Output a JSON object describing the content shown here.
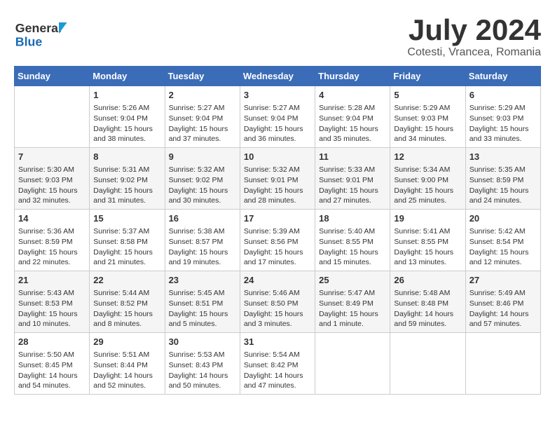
{
  "header": {
    "logo_line1": "General",
    "logo_line2": "Blue",
    "month_year": "July 2024",
    "location": "Cotesti, Vrancea, Romania"
  },
  "weekdays": [
    "Sunday",
    "Monday",
    "Tuesday",
    "Wednesday",
    "Thursday",
    "Friday",
    "Saturday"
  ],
  "weeks": [
    [
      {
        "day": "",
        "info": ""
      },
      {
        "day": "1",
        "info": "Sunrise: 5:26 AM\nSunset: 9:04 PM\nDaylight: 15 hours\nand 38 minutes."
      },
      {
        "day": "2",
        "info": "Sunrise: 5:27 AM\nSunset: 9:04 PM\nDaylight: 15 hours\nand 37 minutes."
      },
      {
        "day": "3",
        "info": "Sunrise: 5:27 AM\nSunset: 9:04 PM\nDaylight: 15 hours\nand 36 minutes."
      },
      {
        "day": "4",
        "info": "Sunrise: 5:28 AM\nSunset: 9:04 PM\nDaylight: 15 hours\nand 35 minutes."
      },
      {
        "day": "5",
        "info": "Sunrise: 5:29 AM\nSunset: 9:03 PM\nDaylight: 15 hours\nand 34 minutes."
      },
      {
        "day": "6",
        "info": "Sunrise: 5:29 AM\nSunset: 9:03 PM\nDaylight: 15 hours\nand 33 minutes."
      }
    ],
    [
      {
        "day": "7",
        "info": "Sunrise: 5:30 AM\nSunset: 9:03 PM\nDaylight: 15 hours\nand 32 minutes."
      },
      {
        "day": "8",
        "info": "Sunrise: 5:31 AM\nSunset: 9:02 PM\nDaylight: 15 hours\nand 31 minutes."
      },
      {
        "day": "9",
        "info": "Sunrise: 5:32 AM\nSunset: 9:02 PM\nDaylight: 15 hours\nand 30 minutes."
      },
      {
        "day": "10",
        "info": "Sunrise: 5:32 AM\nSunset: 9:01 PM\nDaylight: 15 hours\nand 28 minutes."
      },
      {
        "day": "11",
        "info": "Sunrise: 5:33 AM\nSunset: 9:01 PM\nDaylight: 15 hours\nand 27 minutes."
      },
      {
        "day": "12",
        "info": "Sunrise: 5:34 AM\nSunset: 9:00 PM\nDaylight: 15 hours\nand 25 minutes."
      },
      {
        "day": "13",
        "info": "Sunrise: 5:35 AM\nSunset: 8:59 PM\nDaylight: 15 hours\nand 24 minutes."
      }
    ],
    [
      {
        "day": "14",
        "info": "Sunrise: 5:36 AM\nSunset: 8:59 PM\nDaylight: 15 hours\nand 22 minutes."
      },
      {
        "day": "15",
        "info": "Sunrise: 5:37 AM\nSunset: 8:58 PM\nDaylight: 15 hours\nand 21 minutes."
      },
      {
        "day": "16",
        "info": "Sunrise: 5:38 AM\nSunset: 8:57 PM\nDaylight: 15 hours\nand 19 minutes."
      },
      {
        "day": "17",
        "info": "Sunrise: 5:39 AM\nSunset: 8:56 PM\nDaylight: 15 hours\nand 17 minutes."
      },
      {
        "day": "18",
        "info": "Sunrise: 5:40 AM\nSunset: 8:55 PM\nDaylight: 15 hours\nand 15 minutes."
      },
      {
        "day": "19",
        "info": "Sunrise: 5:41 AM\nSunset: 8:55 PM\nDaylight: 15 hours\nand 13 minutes."
      },
      {
        "day": "20",
        "info": "Sunrise: 5:42 AM\nSunset: 8:54 PM\nDaylight: 15 hours\nand 12 minutes."
      }
    ],
    [
      {
        "day": "21",
        "info": "Sunrise: 5:43 AM\nSunset: 8:53 PM\nDaylight: 15 hours\nand 10 minutes."
      },
      {
        "day": "22",
        "info": "Sunrise: 5:44 AM\nSunset: 8:52 PM\nDaylight: 15 hours\nand 8 minutes."
      },
      {
        "day": "23",
        "info": "Sunrise: 5:45 AM\nSunset: 8:51 PM\nDaylight: 15 hours\nand 5 minutes."
      },
      {
        "day": "24",
        "info": "Sunrise: 5:46 AM\nSunset: 8:50 PM\nDaylight: 15 hours\nand 3 minutes."
      },
      {
        "day": "25",
        "info": "Sunrise: 5:47 AM\nSunset: 8:49 PM\nDaylight: 15 hours\nand 1 minute."
      },
      {
        "day": "26",
        "info": "Sunrise: 5:48 AM\nSunset: 8:48 PM\nDaylight: 14 hours\nand 59 minutes."
      },
      {
        "day": "27",
        "info": "Sunrise: 5:49 AM\nSunset: 8:46 PM\nDaylight: 14 hours\nand 57 minutes."
      }
    ],
    [
      {
        "day": "28",
        "info": "Sunrise: 5:50 AM\nSunset: 8:45 PM\nDaylight: 14 hours\nand 54 minutes."
      },
      {
        "day": "29",
        "info": "Sunrise: 5:51 AM\nSunset: 8:44 PM\nDaylight: 14 hours\nand 52 minutes."
      },
      {
        "day": "30",
        "info": "Sunrise: 5:53 AM\nSunset: 8:43 PM\nDaylight: 14 hours\nand 50 minutes."
      },
      {
        "day": "31",
        "info": "Sunrise: 5:54 AM\nSunset: 8:42 PM\nDaylight: 14 hours\nand 47 minutes."
      },
      {
        "day": "",
        "info": ""
      },
      {
        "day": "",
        "info": ""
      },
      {
        "day": "",
        "info": ""
      }
    ]
  ]
}
